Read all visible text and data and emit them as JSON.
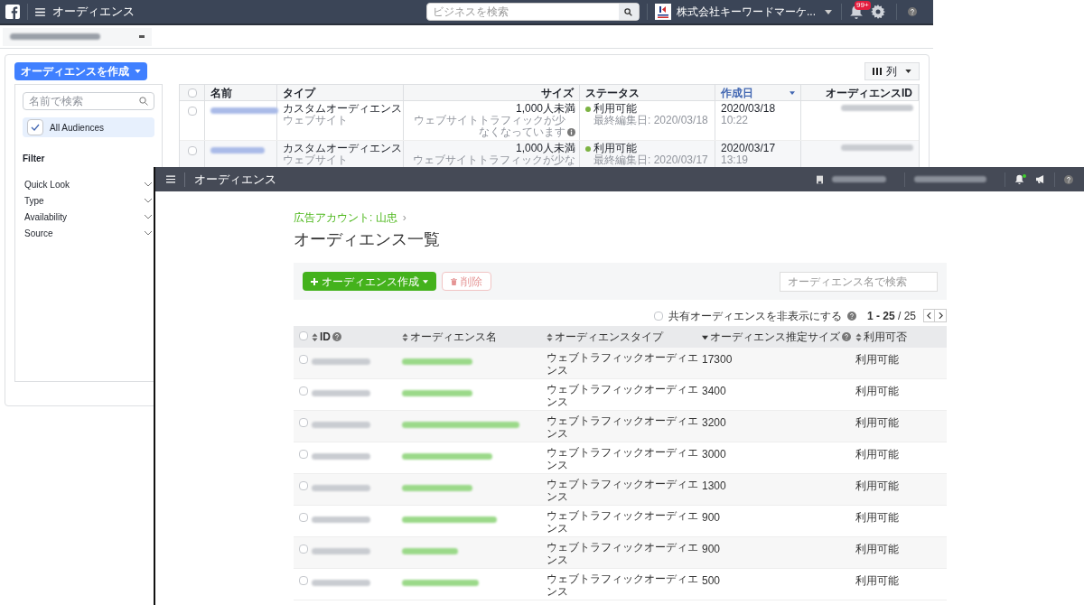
{
  "back_window": {
    "header": {
      "title": "オーディエンス",
      "search_placeholder": "ビジネスを検索",
      "account": "株式会社キーワードマーケ...",
      "notification_badge": "99+"
    },
    "create_button": "オーディエンスを作成",
    "columns_button": "列",
    "sidebar": {
      "search_placeholder": "名前で検索",
      "audience_filter": {
        "label": "All Audiences",
        "checked": true
      },
      "filter_title": "Filter",
      "filters": [
        {
          "label": "Quick Look",
          "expanded": false
        },
        {
          "label": "Type",
          "expanded": false
        },
        {
          "label": "Availability",
          "expanded": false
        },
        {
          "label": "Source",
          "expanded": false
        }
      ]
    },
    "table": {
      "header_checked": false,
      "columns": [
        {
          "label": "名前",
          "selected": false
        },
        {
          "label": "タイプ",
          "selected": false
        },
        {
          "label": "サイズ",
          "selected": false
        },
        {
          "label": "ステータス",
          "selected": false
        },
        {
          "label": "作成日",
          "selected": true
        },
        {
          "label": "オーディエンスID",
          "selected": false
        }
      ],
      "rows": [
        {
          "checked": false,
          "type": "カスタムオーディエンス",
          "subtype": "ウェブサイト",
          "size": "1,000人未満",
          "size_note": "ウェブサイトトラフィックが少なくなっています",
          "note_info": true,
          "status": "利用可能",
          "color": "#7cb342",
          "last_edited": "最終編集日: 2020/03/18",
          "date": "2020/03/18",
          "time": "10:22"
        },
        {
          "checked": false,
          "type": "カスタムオーディエンス",
          "subtype": "ウェブサイト",
          "size": "1,000人未満",
          "size_note": "ウェブサイトトラフィックが少な",
          "note_info": false,
          "status": "利用可能",
          "color": "#7cb342",
          "last_edited": "最終編集日: 2020/03/17",
          "date": "2020/03/17",
          "time": "13:19"
        }
      ]
    }
  },
  "front_window": {
    "header": {
      "title": "オーディエンス",
      "new_notification": true
    },
    "breadcrumb": "広告アカウント: 山忠",
    "breadcrumb_separator": "›",
    "title": "オーディエンス一覧",
    "create_button": "オーディエンス作成",
    "delete_button": {
      "label": "削除",
      "disabled": true
    },
    "search_placeholder": "オーディエンス名で検索",
    "hide_shared": {
      "label": "共有オーディエンスを非表示にする",
      "checked": false
    },
    "pagination": "**1 - 25** / 25",
    "header_checked": false,
    "columns": [
      {
        "label": "ID",
        "sorted": false,
        "help": true
      },
      {
        "label": "オーディエンス名",
        "sorted": false,
        "help": false
      },
      {
        "label": "オーディエンスタイプ",
        "sorted": false,
        "help": false
      },
      {
        "label": "オーディエンス推定サイズ",
        "sorted": true,
        "help": true
      },
      {
        "label": "利用可否",
        "sorted": false,
        "help": false
      }
    ],
    "rows": [
      {
        "checked": false,
        "type": "ウェブトラフィックオーディエンス",
        "size": "17300",
        "availability": "利用可能"
      },
      {
        "checked": false,
        "type": "ウェブトラフィックオーディエンス",
        "size": "3400",
        "availability": "利用可能"
      },
      {
        "checked": false,
        "type": "ウェブトラフィックオーディエンス",
        "size": "3200",
        "availability": "利用可能"
      },
      {
        "checked": false,
        "type": "ウェブトラフィックオーディエンス",
        "size": "3000",
        "availability": "利用可能"
      },
      {
        "checked": false,
        "type": "ウェブトラフィックオーディエンス",
        "size": "1300",
        "availability": "利用可能"
      },
      {
        "checked": false,
        "type": "ウェブトラフィックオーディエンス",
        "size": "900",
        "availability": "利用可能"
      },
      {
        "checked": false,
        "type": "ウェブトラフィックオーディエンス",
        "size": "900",
        "availability": "利用可能"
      },
      {
        "checked": false,
        "type": "ウェブトラフィックオーディエンス",
        "size": "500",
        "availability": "利用可能"
      }
    ]
  }
}
